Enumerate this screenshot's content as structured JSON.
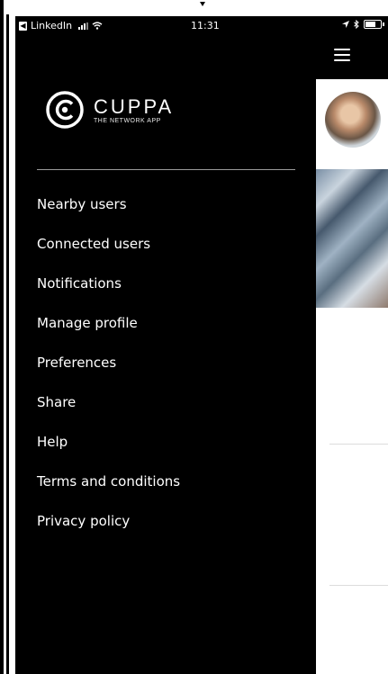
{
  "status_bar": {
    "back_app": "LinkedIn",
    "time": "11:31"
  },
  "brand": {
    "name": "CUPPA",
    "tagline": "THE NETWORK APP"
  },
  "menu": {
    "items": [
      {
        "label": "Nearby users"
      },
      {
        "label": "Connected users"
      },
      {
        "label": "Notifications"
      },
      {
        "label": "Manage profile"
      },
      {
        "label": "Preferences"
      },
      {
        "label": "Share"
      },
      {
        "label": "Help"
      },
      {
        "label": "Terms and conditions"
      },
      {
        "label": "Privacy policy"
      }
    ]
  },
  "icons": {
    "menu": "hamburger-icon",
    "logo": "cuppa-logo-icon",
    "wifi": "wifi-icon",
    "signal": "cellular-signal-icon",
    "battery": "battery-icon",
    "location": "location-arrow-icon",
    "bluetooth": "bluetooth-icon"
  },
  "colors": {
    "drawer_background": "#000000",
    "drawer_text": "#ffffff",
    "divider": "#9a9a9a",
    "content_background": "#ffffff"
  }
}
